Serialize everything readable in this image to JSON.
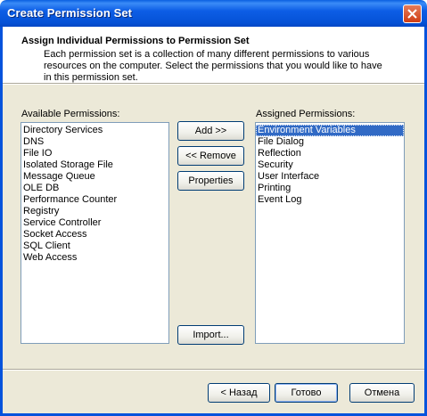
{
  "window": {
    "title": "Create Permission Set"
  },
  "header": {
    "title": "Assign Individual Permissions to Permission Set",
    "description": "Each permission set is a collection of many different permissions to various resources on the computer.  Select the permissions that you would like to have in this permission set."
  },
  "available": {
    "label": "Available Permissions:",
    "items": [
      "Directory Services",
      "DNS",
      "File IO",
      "Isolated Storage File",
      "Message Queue",
      "OLE DB",
      "Performance Counter",
      "Registry",
      "Service Controller",
      "Socket Access",
      "SQL Client",
      "Web Access"
    ]
  },
  "assigned": {
    "label": "Assigned Permissions:",
    "items": [
      "Environment Variables",
      "File Dialog",
      "Reflection",
      "Security",
      "User Interface",
      "Printing",
      "Event Log"
    ],
    "selected": "Environment Variables"
  },
  "actions": {
    "add": "Add >>",
    "remove": "<< Remove",
    "properties": "Properties",
    "import": "Import..."
  },
  "footer": {
    "back": "< Назад",
    "finish": "Готово",
    "cancel": "Отмена"
  },
  "colors": {
    "title_bar": "#0553dc",
    "selection": "#316ac5",
    "close_button": "#cf3d14"
  }
}
